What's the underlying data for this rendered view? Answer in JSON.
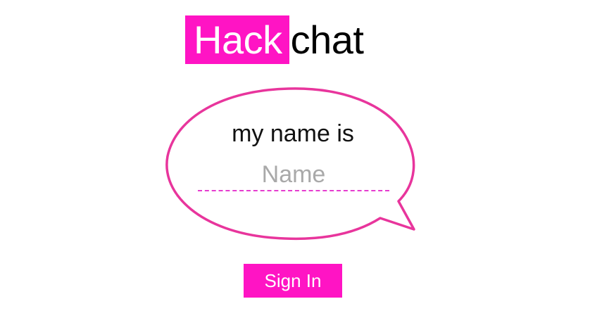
{
  "logo": {
    "highlight_text": "Hack",
    "plain_text": "chat"
  },
  "form": {
    "prompt": "my name is",
    "name_placeholder": "Name",
    "name_value": "",
    "submit_label": "Sign In"
  },
  "colors": {
    "accent": "#ff14c4",
    "bubble_stroke": "#e8359c",
    "placeholder": "#a9a9a9",
    "text": "#111111"
  },
  "icons": {
    "bubble": "speech-bubble-icon"
  }
}
